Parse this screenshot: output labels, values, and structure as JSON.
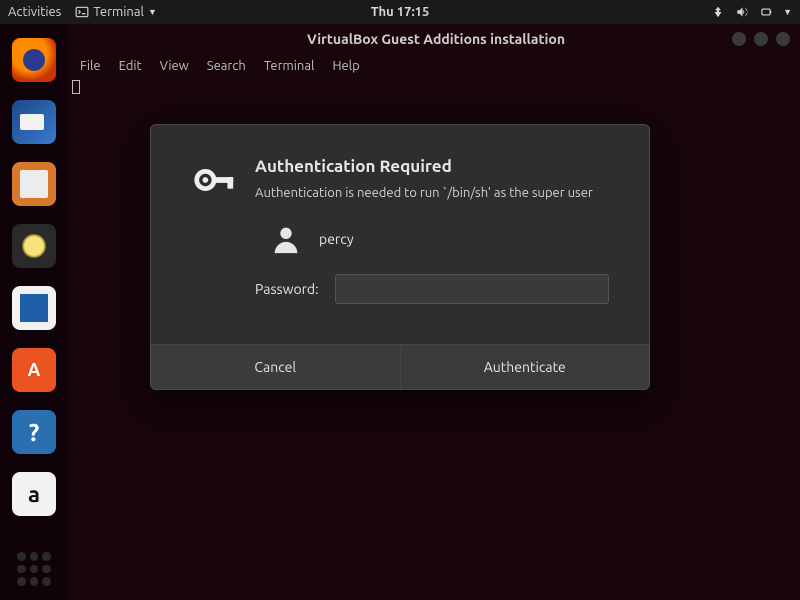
{
  "topbar": {
    "activities": "Activities",
    "app_indicator": "Terminal",
    "clock": "Thu 17:15"
  },
  "window": {
    "title": "VirtualBox Guest Additions installation"
  },
  "menubar": {
    "items": [
      "File",
      "Edit",
      "View",
      "Search",
      "Terminal",
      "Help"
    ]
  },
  "dock": {
    "items": [
      {
        "name": "firefox"
      },
      {
        "name": "thunderbird"
      },
      {
        "name": "files"
      },
      {
        "name": "rhythmbox"
      },
      {
        "name": "libreoffice-writer"
      },
      {
        "name": "ubuntu-software"
      },
      {
        "name": "help"
      },
      {
        "name": "amazon"
      }
    ]
  },
  "auth_dialog": {
    "title": "Authentication Required",
    "message": "Authentication is needed to run `/bin/sh' as the super user",
    "username": "percy",
    "password_label": "Password:",
    "password_value": "",
    "cancel_label": "Cancel",
    "authenticate_label": "Authenticate"
  }
}
